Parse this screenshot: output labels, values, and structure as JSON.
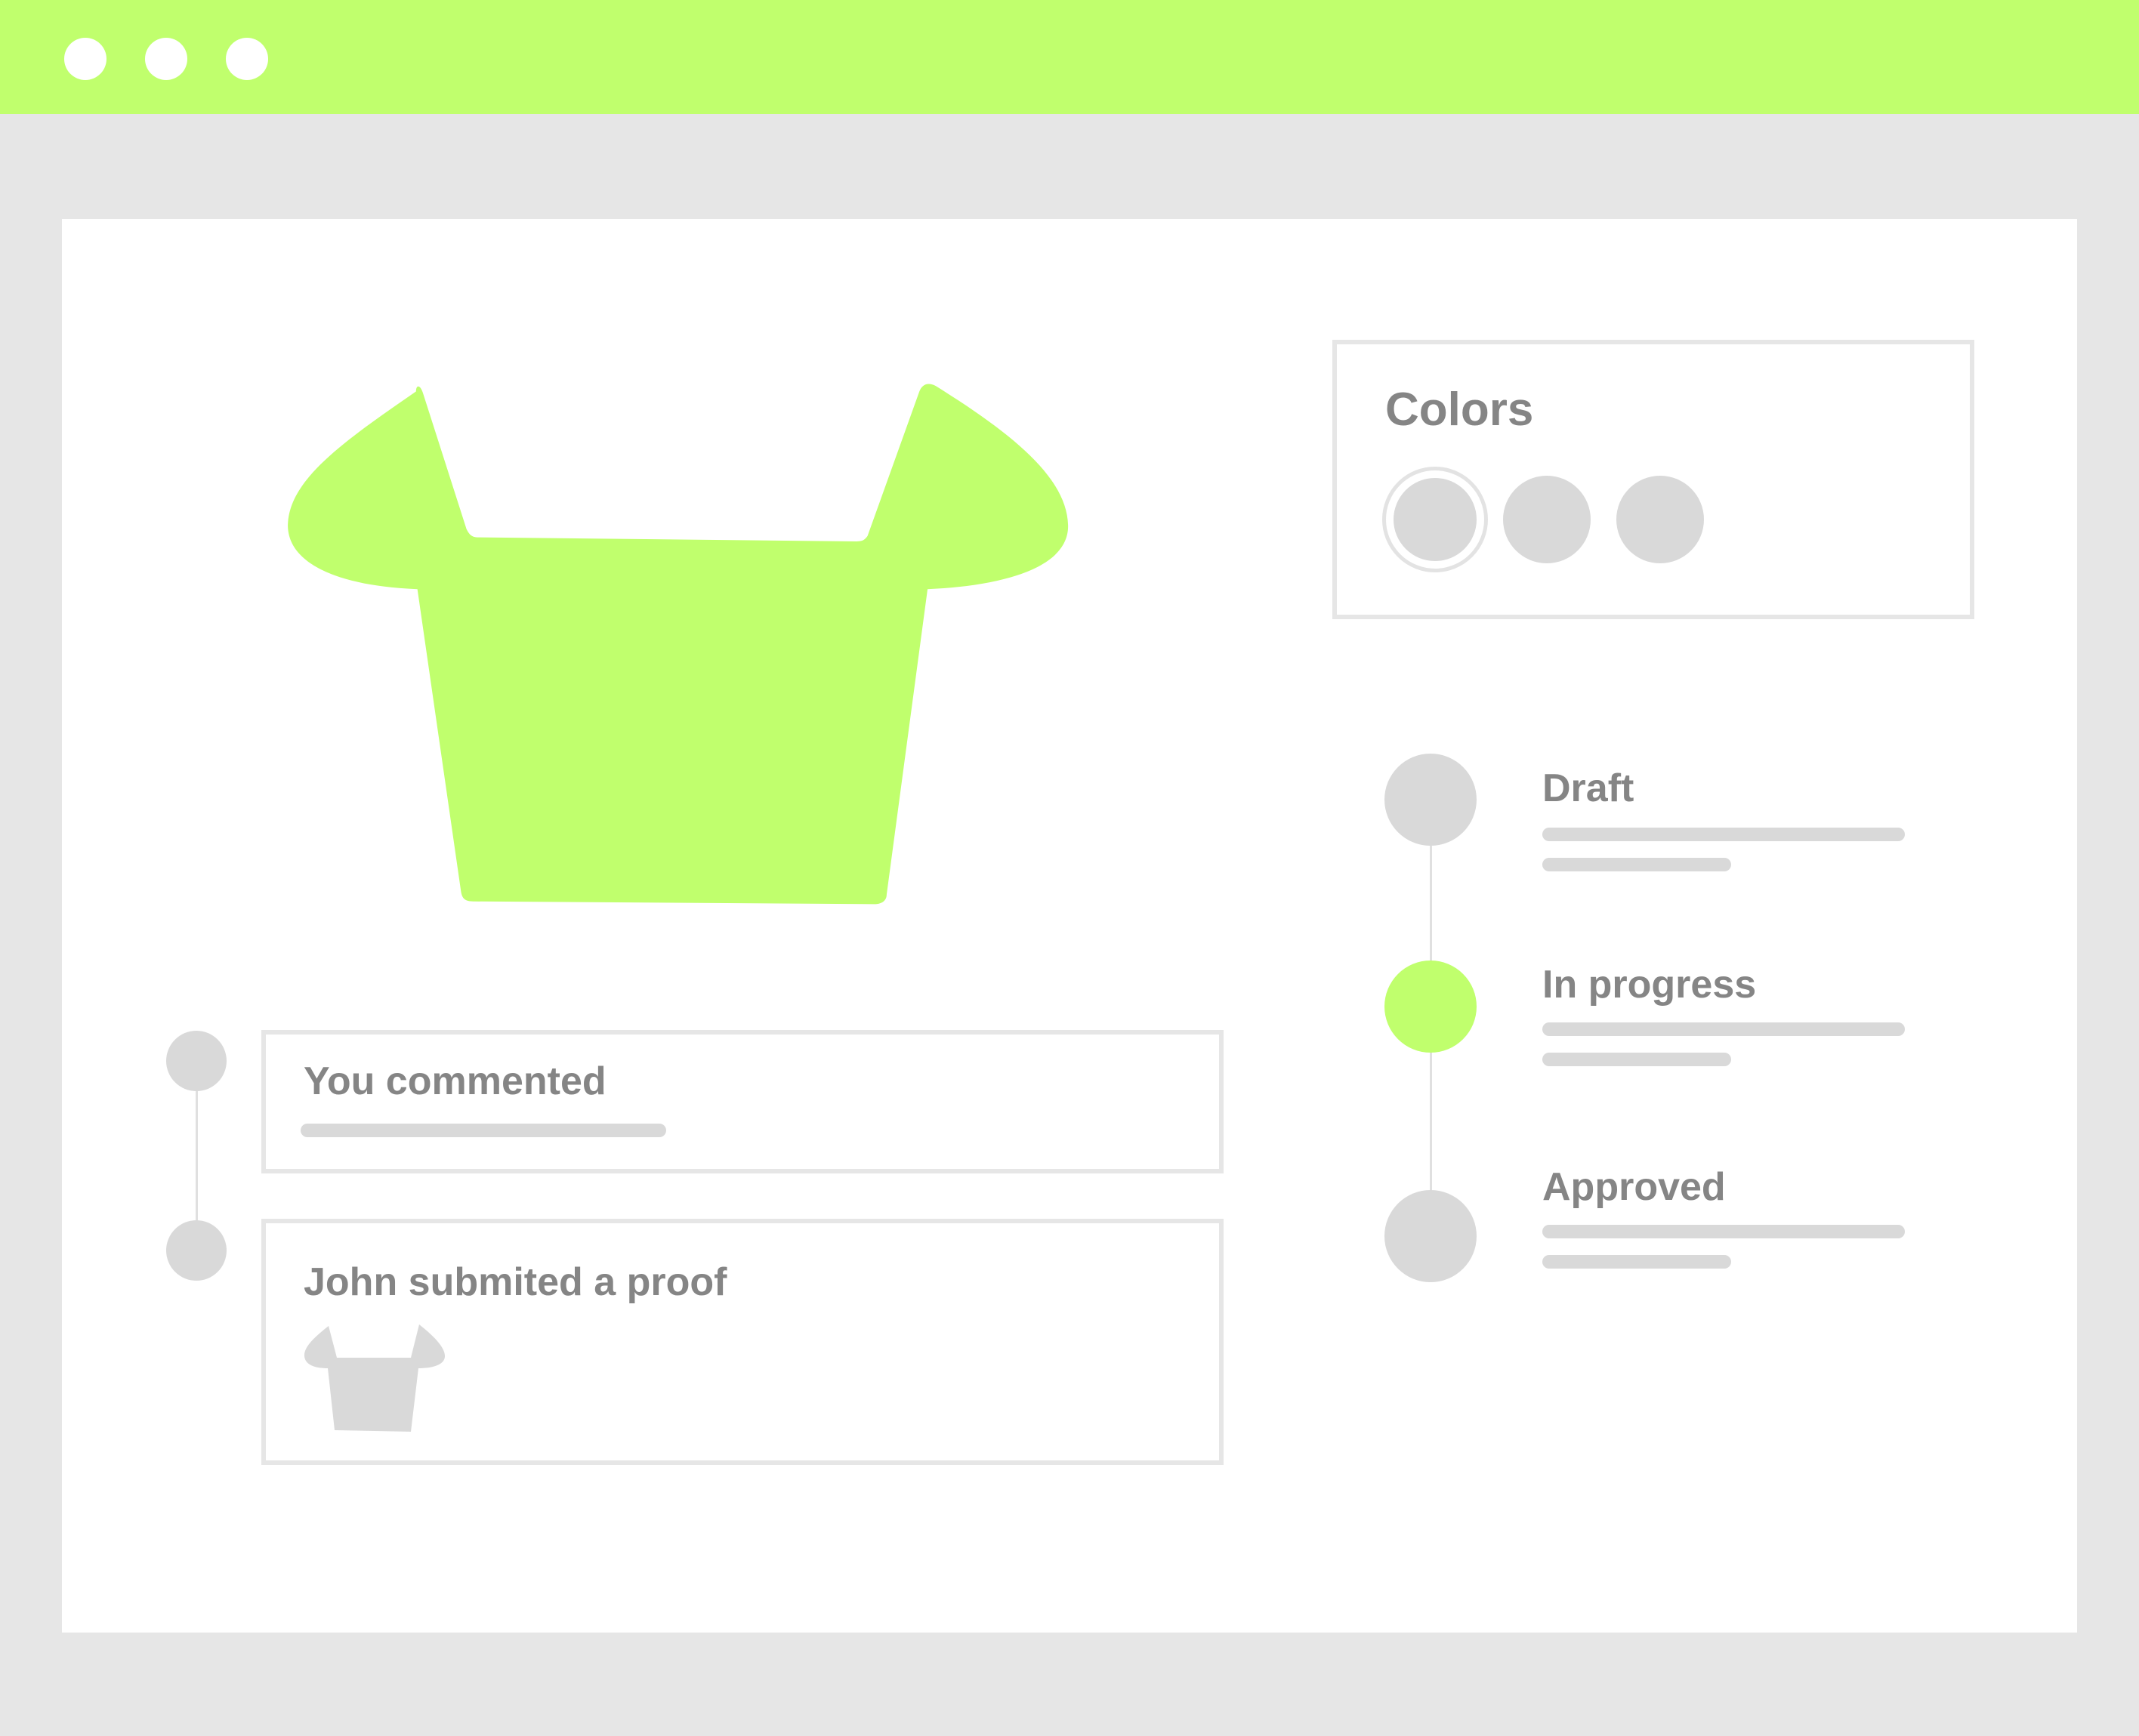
{
  "window": {
    "controls": [
      "window-control-dot",
      "window-control-dot",
      "window-control-dot"
    ]
  },
  "product": {
    "color": "#c0ff6d"
  },
  "colors_panel": {
    "title": "Colors",
    "swatches": [
      {
        "name": "swatch-1",
        "selected": true
      },
      {
        "name": "swatch-2",
        "selected": false
      },
      {
        "name": "swatch-3",
        "selected": false
      }
    ]
  },
  "status_timeline": {
    "steps": [
      {
        "label": "Draft",
        "active": false
      },
      {
        "label": "In progress",
        "active": true
      },
      {
        "label": "Approved",
        "active": false
      }
    ]
  },
  "activity_feed": {
    "items": [
      {
        "title": "You commented"
      },
      {
        "title": "John submited a proof"
      }
    ]
  },
  "colors": {
    "accent": "#c0ff6d",
    "neutral": "#d9d9d9",
    "frame": "#e6e6e6",
    "text": "#858585"
  }
}
